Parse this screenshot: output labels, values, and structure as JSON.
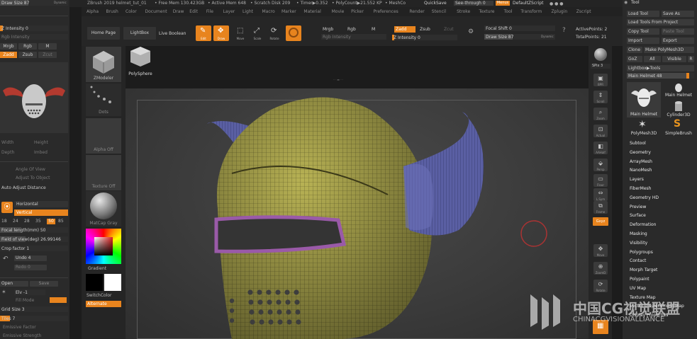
{
  "titlebar": {
    "app_title": "ZBrush 2019 helmet_tut_01",
    "free_mem": "• Free Mem 130.423GB",
    "active_mem": "• Active Mem 648",
    "scratch_disk": "• Scratch Disk 209",
    "timer": "• Timer▶0.352",
    "poly_count": "• PolyCount▶21.552 KP",
    "mesh_count": "• MeshCo",
    "quicksave": "QuickSave",
    "see_through": "See-through  0",
    "menus": "Menus",
    "default_zscript": "DefaultZScript"
  },
  "menubar": [
    "Alpha",
    "Brush",
    "Color",
    "Document",
    "Draw",
    "Edit",
    "File",
    "Layer",
    "Light",
    "Macro",
    "Marker",
    "Material",
    "Movie",
    "Picker",
    "Preferences",
    "Render",
    "Stencil",
    "Stroke",
    "Texture",
    "Tool",
    "Transform",
    "Zplugin",
    "Zscript"
  ],
  "top_shelf": {
    "home_page": "Home Page",
    "lightbox": "LightBox",
    "live_boolean": "Live Boolean",
    "edit": "Edit",
    "draw": "Draw",
    "move": "Move",
    "scale": "Scale",
    "rotate": "Rotate",
    "mrgb": "Mrgb",
    "rgb": "Rgb",
    "m": "M",
    "rgb_intensity": "Rgb Intensity",
    "zadd": "Zadd",
    "zsub": "Zsub",
    "zcut": "Zcut",
    "z_intensity": "Z Intensity 0",
    "focal_shift": "Focal Shift 0",
    "draw_size": "Draw Size 87",
    "dynamic": "Dynamic",
    "active_points": "ActivePoints: 2",
    "total_points": "TotalPoints: 21"
  },
  "left_panel": {
    "draw_size": "Draw Size 87",
    "dynamic": "Dynamic",
    "z_intensity": "Z Intensity 0",
    "rgb_intensity": "Rgb Intensity",
    "mrgb": "Mrgb",
    "rgb": "Rgb",
    "m": "M",
    "zadd": "Zadd",
    "zsub": "Zsub",
    "zcut": "Zcut",
    "width": "Width",
    "height": "Height",
    "depth": "Depth",
    "imbed": "Imbed",
    "angle_of_view": "Angle Of View",
    "adjust_to_object": "Adjust To Object",
    "auto_adjust_distance": "Auto Adjust Distance",
    "horizontal": "Horizontal",
    "vertical": "Vertical",
    "fov_presets": [
      "18",
      "24",
      "28",
      "35",
      "50",
      "85"
    ],
    "fov_active": "50",
    "focal_length": "Focal length(mm) 50",
    "field_of_view": "Field of view(deg) 26.99146",
    "crop_factor": "Crop factor 1",
    "undo": "Undo 4",
    "redo": "Redo 0",
    "open": "Open",
    "save": "Save",
    "elv": "Elv -1",
    "fill_mode": "Fill Mode",
    "grid_size": "Grid Size 3",
    "tiles": "Tiles 7",
    "emissive": "Emissive Factor",
    "emissive2": "Emissive Strength"
  },
  "left_tray": {
    "zmodeler": "ZModeler",
    "polysphere": "PolySphere",
    "dots": "Dots",
    "alpha_off": "Alpha Off",
    "texture_off": "Texture Off",
    "matcap": "MatCap Gray",
    "gradient": "Gradient",
    "switch_color": "SwitchColor",
    "alternate": "Alternate"
  },
  "right_shelf": {
    "spix": "SPix 3",
    "buttons": [
      "BPR",
      "Scroll",
      "Zoom",
      "Actual",
      "AAHalf",
      "Persp",
      "Floor",
      "L.Sym",
      "Frame",
      "Move",
      "ZoomD",
      "Rotate"
    ],
    "gxyz": "Gxyz"
  },
  "tool_palette": {
    "header": "Tool",
    "load_tool": "Load Tool",
    "save_as": "Save As",
    "load_from_project": "Load Tools From Project",
    "copy_tool": "Copy Tool",
    "paste_tool": "Paste Tool",
    "import": "Import",
    "export": "Export",
    "clone": "Clone",
    "make_polymesh": "Make PolyMesh3D",
    "goz": "GoZ",
    "all": "All",
    "visible": "Visible",
    "r": "R",
    "lightbox_tools": "Lightbox▶Tools",
    "main_helmet_slider": "Main Helmet  48",
    "thumb_main_helmet": "Main Helmet",
    "thumb_main_helmet_2": "Main Helmet",
    "thumb_cylinder": "Cylinder3D",
    "thumb_polymesh": "PolyMesh3D",
    "thumb_simplebrush": "SimpleBrush",
    "subpalettes": [
      "Subtool",
      "Geometry",
      "ArrayMesh",
      "NanoMesh",
      "Layers",
      "FiberMesh",
      "Geometry HD",
      "Preview",
      "Surface",
      "Deformation",
      "Masking",
      "Visibility",
      "Polygroups",
      "Contact",
      "Morph Target",
      "Polypaint",
      "UV Map",
      "Texture Map",
      "Vector Displacement Map",
      "Display Properties"
    ]
  },
  "watermark": {
    "line1": "中国CG视觉联盟",
    "line2": "CHINACGVISIONALLIANCE"
  },
  "colors": {
    "accent": "#e8841e",
    "bg": "#1c1c1c",
    "panel": "#2b2b2b",
    "helmet": "#b8b254",
    "horn": "#5a5fa3",
    "trim": "#9a5aa8"
  }
}
